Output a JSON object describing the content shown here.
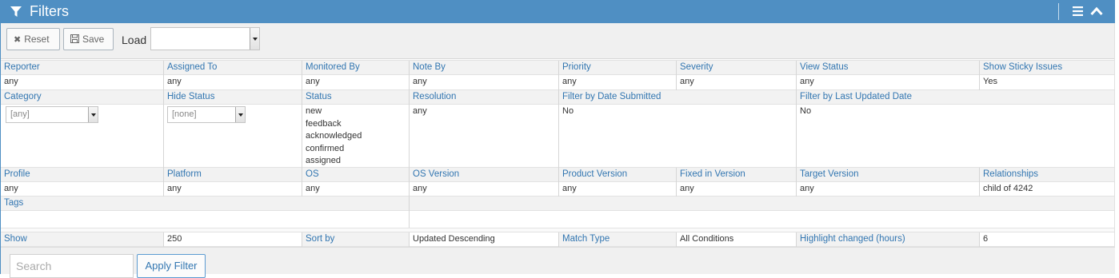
{
  "header": {
    "title": "Filters",
    "filter_icon": "filter-icon",
    "menu_icon": "hamburger-icon",
    "collapse_icon": "chevron-up-icon"
  },
  "toolbar": {
    "reset_label": "Reset",
    "save_label": "Save",
    "load_label": "Load",
    "load_value": ""
  },
  "row1": {
    "labels": [
      "Reporter",
      "Assigned To",
      "Monitored By",
      "Note By",
      "Priority",
      "Severity",
      "View Status",
      "Show Sticky Issues"
    ],
    "values": [
      "any",
      "any",
      "any",
      "any",
      "any",
      "any",
      "any",
      "Yes"
    ]
  },
  "row2": {
    "labels": [
      "Category",
      "Hide Status",
      "Status",
      "Resolution",
      "Filter by Date Submitted",
      "Filter by Last Updated Date"
    ],
    "category_value": "[any]",
    "hide_status_value": "[none]",
    "status_values": [
      "new",
      "feedback",
      "acknowledged",
      "confirmed",
      "assigned"
    ],
    "resolution_value": "any",
    "date_submitted_value": "No",
    "last_updated_value": "No"
  },
  "row3": {
    "labels": [
      "Profile",
      "Platform",
      "OS",
      "OS Version",
      "Product Version",
      "Fixed in Version",
      "Target Version",
      "Relationships"
    ],
    "values": [
      "any",
      "any",
      "any",
      "any",
      "any",
      "any",
      "any",
      "child of 4242"
    ]
  },
  "row4": {
    "tags_label": "Tags",
    "tags_value": ""
  },
  "row5": {
    "show_label": "Show",
    "show_value": "250",
    "sort_label": "Sort by",
    "sort_value": "Updated Descending",
    "match_label": "Match Type",
    "match_value": "All Conditions",
    "highlight_label": "Highlight changed (hours)",
    "highlight_value": "6"
  },
  "footer": {
    "search_placeholder": "Search",
    "apply_label": "Apply Filter"
  },
  "colors": {
    "header_bg": "#4f8fc3",
    "label_text": "#3276b1",
    "label_bg": "#f2f2f2",
    "toolbar_bg": "#f0f0f0"
  }
}
